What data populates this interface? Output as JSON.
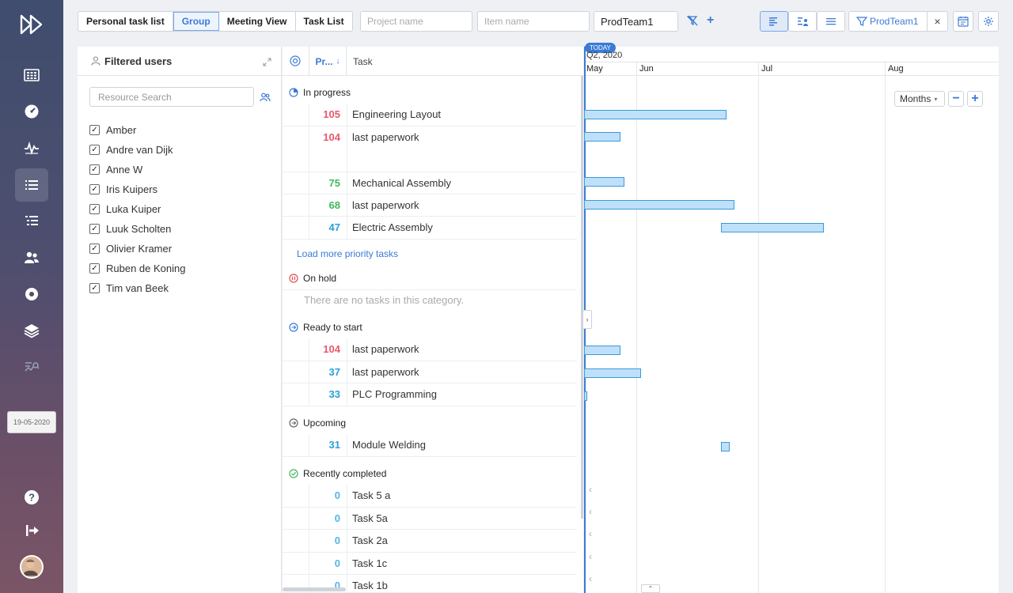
{
  "toolbar": {
    "tabs": [
      {
        "label": "Personal task list",
        "active": false
      },
      {
        "label": "Group",
        "active": true
      },
      {
        "label": "Meeting View",
        "active": false
      },
      {
        "label": "Task List",
        "active": false
      }
    ],
    "project_placeholder": "Project name",
    "item_placeholder": "Item name",
    "team_value": "ProdTeam1",
    "group_chip_label": "ProdTeam1"
  },
  "nav": {
    "date": "19-05-2020",
    "icons": [
      "grid-icon",
      "gauge-icon",
      "pulse-icon",
      "list-icon",
      "checklist-icon",
      "users-icon",
      "gear-icon",
      "layers-icon",
      "filter-chart-icon"
    ]
  },
  "users": {
    "title": "Filtered users",
    "search_placeholder": "Resource Search",
    "items": [
      "Amber",
      "Andre van Dijk",
      "Anne W",
      "Iris Kuipers",
      "Luka Kuiper",
      "Luuk Scholten",
      "Olivier Kramer",
      "Ruben de Koning",
      "Tim van Beek"
    ]
  },
  "tasks": {
    "col_priority": "Pr...",
    "col_task": "Task",
    "load_more": "Load more priority tasks",
    "no_tasks": "There are no tasks in this category.",
    "categories": {
      "in_progress": "In progress",
      "on_hold": "On hold",
      "ready": "Ready to start",
      "upcoming": "Upcoming",
      "completed": "Recently completed"
    },
    "rows": [
      {
        "priority": "105",
        "name": "Engineering Layout",
        "color": "#e8596d"
      },
      {
        "priority": "104",
        "name": "last paperwork",
        "color": "#e8596d"
      },
      {
        "priority": "75",
        "name": "Mechanical Assembly",
        "color": "#41b85b"
      },
      {
        "priority": "68",
        "name": "last paperwork",
        "color": "#41b85b"
      },
      {
        "priority": "47",
        "name": "Electric Assembly",
        "color": "#2a9fd8"
      },
      {
        "priority": "104",
        "name": "last paperwork",
        "color": "#e8596d"
      },
      {
        "priority": "37",
        "name": "last paperwork",
        "color": "#2a9fd8"
      },
      {
        "priority": "33",
        "name": "PLC Programming",
        "color": "#2a9fd8"
      },
      {
        "priority": "31",
        "name": "Module Welding",
        "color": "#2a9fd8"
      },
      {
        "priority": "0",
        "name": "Task 5 a",
        "color": "#4fb7e8"
      },
      {
        "priority": "0",
        "name": "Task 5a",
        "color": "#4fb7e8"
      },
      {
        "priority": "0",
        "name": "Task 2a",
        "color": "#4fb7e8"
      },
      {
        "priority": "0",
        "name": "Task 1c",
        "color": "#4fb7e8"
      },
      {
        "priority": "0",
        "name": "Task 1b",
        "color": "#4fb7e8"
      }
    ]
  },
  "gantt": {
    "today_label": "TODAY",
    "quarter": "Q2, 2020",
    "months": [
      "May",
      "Jun",
      "Jul",
      "Aug"
    ],
    "zoom_label": "Months"
  }
}
